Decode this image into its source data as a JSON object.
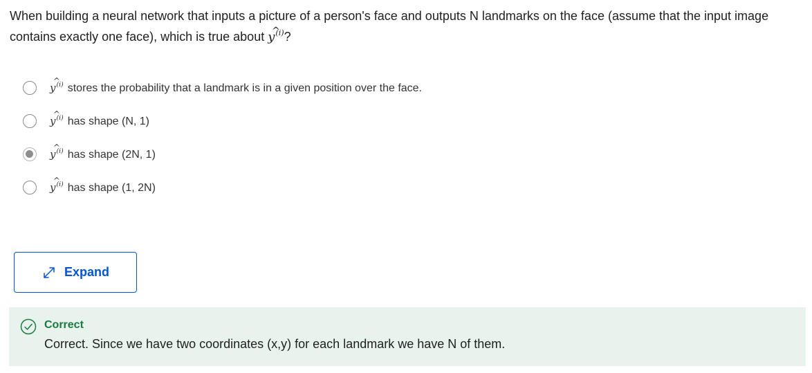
{
  "question": {
    "text_before": "When building a neural network that inputs a picture of a person's face and outputs N landmarks on the face (assume that the input image contains exactly one face), which is true about ",
    "math_symbol": "y",
    "math_hat": "^",
    "math_superscript": "(i)",
    "text_after": "?"
  },
  "options": [
    {
      "symbol": "y",
      "hat": "^",
      "superscript": "(i)",
      "text": "stores the probability that a landmark is in a given position over the face.",
      "selected": false
    },
    {
      "symbol": "y",
      "hat": "^",
      "superscript": "(i)",
      "text": "has shape (N, 1)",
      "selected": false
    },
    {
      "symbol": "y",
      "hat": "^",
      "superscript": "(i)",
      "text": "has shape (2N, 1)",
      "selected": true
    },
    {
      "symbol": "y",
      "hat": "^",
      "superscript": "(i)",
      "text": "has shape (1, 2N)",
      "selected": false
    }
  ],
  "expand": {
    "label": "Expand",
    "icon": "expand-arrows-icon"
  },
  "feedback": {
    "icon": "check-circle-icon",
    "title": "Correct",
    "text": "Correct. Since we have two coordinates (x,y) for each landmark we have N of them."
  },
  "colors": {
    "accent": "#0056d2",
    "success": "#1b7a3e",
    "feedback_bg": "#e8f3ee",
    "radio_border": "#8a8a8a",
    "radio_selected_dot": "#8e8e8e"
  }
}
